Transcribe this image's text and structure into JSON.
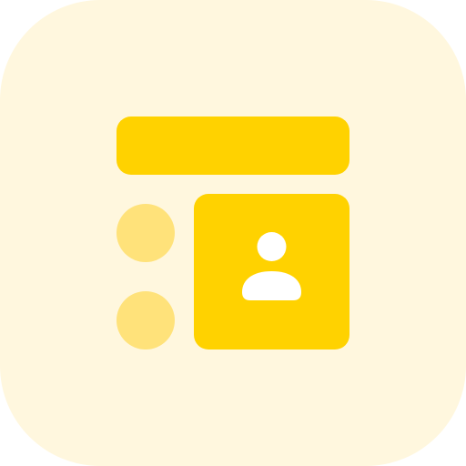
{
  "icon": {
    "name": "profile-list-icon",
    "colors": {
      "background": "#FFF7DE",
      "primary": "#FFD200",
      "secondary": "#FFE27A",
      "foreground": "#FFFFFF"
    }
  }
}
